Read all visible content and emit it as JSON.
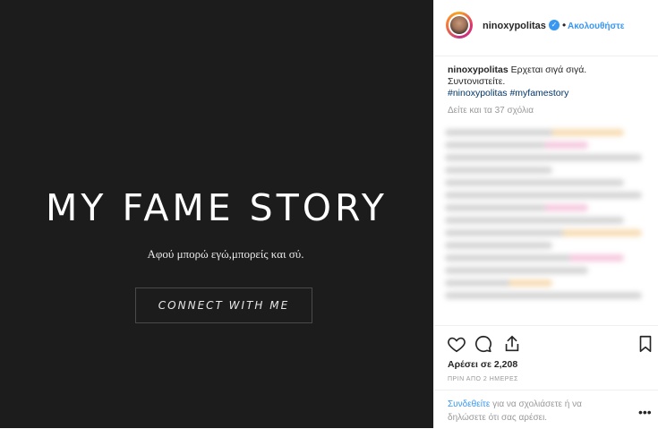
{
  "post_media": {
    "title": "MY FAME STORY",
    "subtitle": "Αφού μπορώ εγώ,μπορείς και σύ.",
    "cta_label": "CONNECT WITH ME"
  },
  "header": {
    "username": "ninoxypolitas",
    "dot": "•",
    "follow_label": "Ακολουθήστε"
  },
  "caption": {
    "username": "ninoxypolitas",
    "line1": " Ερχεται σιγά σιγά.",
    "line2": "Συντονιστείτε.",
    "hashtags": "#ninoxypolitas #myfamestory"
  },
  "comments": {
    "view_all": "Δείτε και τα 37 σχόλια"
  },
  "engagement": {
    "likes": "Αρέσει σε 2,208",
    "time": "ΠΡΙΝ ΑΠΟ 2 ΗΜΕΡΕΣ"
  },
  "footer": {
    "login_link": "Συνδεθείτε",
    "login_text": " για να σχολιάσετε ή να δηλώσετε ότι σας αρέσει.",
    "more": "•••"
  },
  "icons": [
    "verified-icon",
    "heart-icon",
    "comment-icon",
    "share-icon",
    "bookmark-icon"
  ],
  "colors": {
    "accent": "#3897f0",
    "media_bg": "#1c1c1d",
    "muted": "#999999"
  }
}
